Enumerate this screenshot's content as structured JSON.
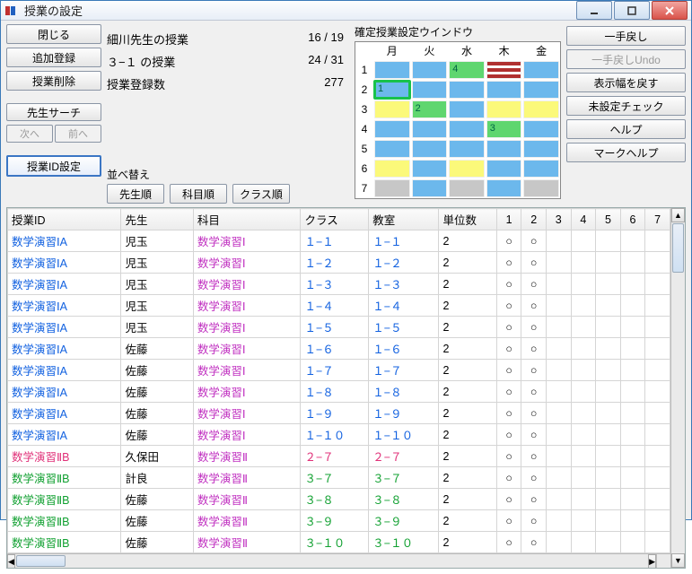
{
  "window": {
    "title": "授業の設定"
  },
  "left_buttons": {
    "close": "閉じる",
    "add": "追加登録",
    "delete": "授業削除",
    "teacher_search": "先生サーチ",
    "next": "次へ",
    "prev": "前へ",
    "id_setting": "授業ID設定"
  },
  "stats": {
    "row1_label": "細川先生の授業",
    "row1_value": "16 / 19",
    "row2_label": "３−１ の授業",
    "row2_value": "24 / 31",
    "row3_label": "授業登録数",
    "row3_value": "277"
  },
  "sort": {
    "label": "並べ替え",
    "by_teacher": "先生順",
    "by_subject": "科目順",
    "by_class": "クラス順"
  },
  "minigrid": {
    "title": "確定授業設定ウインドウ",
    "days": [
      "月",
      "火",
      "水",
      "木",
      "金"
    ],
    "periods": [
      "1",
      "2",
      "3",
      "4",
      "5",
      "6",
      "7"
    ],
    "cells": [
      [
        {
          "c": "blue"
        },
        {
          "c": "blue"
        },
        {
          "c": "green",
          "n": "4"
        },
        {
          "c": "red"
        },
        {
          "c": "blue"
        }
      ],
      [
        {
          "c": "blue",
          "sel": true,
          "n": "1"
        },
        {
          "c": "blue"
        },
        {
          "c": "blue"
        },
        {
          "c": "blue"
        },
        {
          "c": "blue"
        }
      ],
      [
        {
          "c": "yellow"
        },
        {
          "c": "green",
          "n": "2"
        },
        {
          "c": "blue"
        },
        {
          "c": "yellow"
        },
        {
          "c": "yellow"
        }
      ],
      [
        {
          "c": "blue"
        },
        {
          "c": "blue"
        },
        {
          "c": "blue"
        },
        {
          "c": "green",
          "n": "3"
        },
        {
          "c": "blue"
        }
      ],
      [
        {
          "c": "blue"
        },
        {
          "c": "blue"
        },
        {
          "c": "blue"
        },
        {
          "c": "blue"
        },
        {
          "c": "blue"
        }
      ],
      [
        {
          "c": "yellow"
        },
        {
          "c": "blue"
        },
        {
          "c": "yellow"
        },
        {
          "c": "blue"
        },
        {
          "c": "blue"
        }
      ],
      [
        {
          "c": "gray"
        },
        {
          "c": "blue"
        },
        {
          "c": "gray"
        },
        {
          "c": "blue"
        },
        {
          "c": "gray"
        }
      ]
    ]
  },
  "right_buttons": {
    "undo": "一手戻し",
    "undo_en": "一手戻しUndo",
    "reset_width": "表示幅を戻す",
    "check_unset": "未設定チェック",
    "help": "ヘルプ",
    "mark_help": "マークヘルプ"
  },
  "table": {
    "headers": [
      "授業ID",
      "先生",
      "科目",
      "クラス",
      "教室",
      "単位数",
      "1",
      "2",
      "3",
      "4",
      "5",
      "6",
      "7"
    ],
    "rows": [
      {
        "id": "数学演習ⅠA",
        "idc": "blue",
        "teacher": "児玉",
        "subject": "数学演習Ⅰ",
        "cls": "１−１",
        "room": "１−１",
        "units": "2",
        "marks": [
          "○",
          "○",
          "",
          "",
          "",
          "",
          ""
        ]
      },
      {
        "id": "数学演習ⅠA",
        "idc": "blue",
        "teacher": "児玉",
        "subject": "数学演習Ⅰ",
        "cls": "１−２",
        "room": "１−２",
        "units": "2",
        "marks": [
          "○",
          "○",
          "",
          "",
          "",
          "",
          ""
        ]
      },
      {
        "id": "数学演習ⅠA",
        "idc": "blue",
        "teacher": "児玉",
        "subject": "数学演習Ⅰ",
        "cls": "１−３",
        "room": "１−３",
        "units": "2",
        "marks": [
          "○",
          "○",
          "",
          "",
          "",
          "",
          ""
        ]
      },
      {
        "id": "数学演習ⅠA",
        "idc": "blue",
        "teacher": "児玉",
        "subject": "数学演習Ⅰ",
        "cls": "１−４",
        "room": "１−４",
        "units": "2",
        "marks": [
          "○",
          "○",
          "",
          "",
          "",
          "",
          ""
        ]
      },
      {
        "id": "数学演習ⅠA",
        "idc": "blue",
        "teacher": "児玉",
        "subject": "数学演習Ⅰ",
        "cls": "１−５",
        "room": "１−５",
        "units": "2",
        "marks": [
          "○",
          "○",
          "",
          "",
          "",
          "",
          ""
        ]
      },
      {
        "id": "数学演習ⅠA",
        "idc": "blue",
        "teacher": "佐藤",
        "subject": "数学演習Ⅰ",
        "cls": "１−６",
        "room": "１−６",
        "units": "2",
        "marks": [
          "○",
          "○",
          "",
          "",
          "",
          "",
          ""
        ]
      },
      {
        "id": "数学演習ⅠA",
        "idc": "blue",
        "teacher": "佐藤",
        "subject": "数学演習Ⅰ",
        "cls": "１−７",
        "room": "１−７",
        "units": "2",
        "marks": [
          "○",
          "○",
          "",
          "",
          "",
          "",
          ""
        ]
      },
      {
        "id": "数学演習ⅠA",
        "idc": "blue",
        "teacher": "佐藤",
        "subject": "数学演習Ⅰ",
        "cls": "１−８",
        "room": "１−８",
        "units": "2",
        "marks": [
          "○",
          "○",
          "",
          "",
          "",
          "",
          ""
        ]
      },
      {
        "id": "数学演習ⅠA",
        "idc": "blue",
        "teacher": "佐藤",
        "subject": "数学演習Ⅰ",
        "cls": "１−９",
        "room": "１−９",
        "units": "2",
        "marks": [
          "○",
          "○",
          "",
          "",
          "",
          "",
          ""
        ]
      },
      {
        "id": "数学演習ⅠA",
        "idc": "blue",
        "teacher": "佐藤",
        "subject": "数学演習Ⅰ",
        "cls": "１−１０",
        "room": "１−１０",
        "units": "2",
        "marks": [
          "○",
          "○",
          "",
          "",
          "",
          "",
          ""
        ]
      },
      {
        "id": "数学演習ⅡB",
        "idc": "pink",
        "teacher": "久保田",
        "subject": "数学演習Ⅱ",
        "cls": "２−７",
        "room": "２−７",
        "units": "2",
        "marks": [
          "○",
          "○",
          "",
          "",
          "",
          "",
          ""
        ],
        "clsc": "pink"
      },
      {
        "id": "数学演習ⅡB",
        "idc": "green",
        "teacher": "計良",
        "subject": "数学演習Ⅱ",
        "cls": "３−７",
        "room": "３−７",
        "units": "2",
        "marks": [
          "○",
          "○",
          "",
          "",
          "",
          "",
          ""
        ],
        "clsc": "green"
      },
      {
        "id": "数学演習ⅡB",
        "idc": "green",
        "teacher": "佐藤",
        "subject": "数学演習Ⅱ",
        "cls": "３−８",
        "room": "３−８",
        "units": "2",
        "marks": [
          "○",
          "○",
          "",
          "",
          "",
          "",
          ""
        ],
        "clsc": "green"
      },
      {
        "id": "数学演習ⅡB",
        "idc": "green",
        "teacher": "佐藤",
        "subject": "数学演習Ⅱ",
        "cls": "３−９",
        "room": "３−９",
        "units": "2",
        "marks": [
          "○",
          "○",
          "",
          "",
          "",
          "",
          ""
        ],
        "clsc": "green"
      },
      {
        "id": "数学演習ⅡB",
        "idc": "green",
        "teacher": "佐藤",
        "subject": "数学演習Ⅱ",
        "cls": "３−１０",
        "room": "３−１０",
        "units": "2",
        "marks": [
          "○",
          "○",
          "",
          "",
          "",
          "",
          ""
        ],
        "clsc": "green"
      }
    ]
  }
}
